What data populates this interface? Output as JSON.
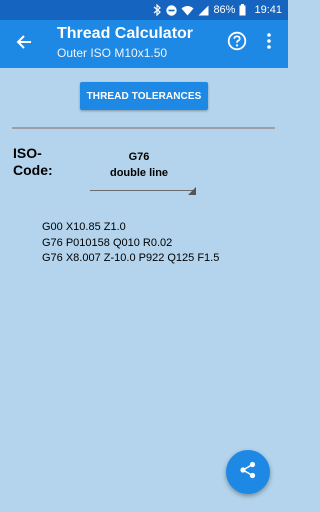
{
  "status_bar": {
    "battery": "86%",
    "time": "19:41"
  },
  "app_bar": {
    "title": "Thread Calculator",
    "subtitle": "Outer ISO M10x1.50"
  },
  "tolerances_button": "THREAD TOLERANCES",
  "iso_code": {
    "label_line1": "ISO-",
    "label_line2": "Code:",
    "selected_line1": "G76",
    "selected_line2": "double line"
  },
  "gcode_lines": [
    "G00 X10.85 Z1.0",
    "G76 P010158 Q010 R0.02",
    "G76 X8.007 Z-10.0 P922 Q125 F1.5"
  ],
  "colors": {
    "status_bar": "#1565c0",
    "app_bar": "#1e88e5",
    "background": "#b3d4ec",
    "accent": "#1e88e5"
  },
  "icons": [
    "bluetooth-icon",
    "do-not-disturb-icon",
    "wifi-icon",
    "signal-icon",
    "battery-icon",
    "back-arrow-icon",
    "help-icon",
    "more-vert-icon",
    "share-icon"
  ]
}
